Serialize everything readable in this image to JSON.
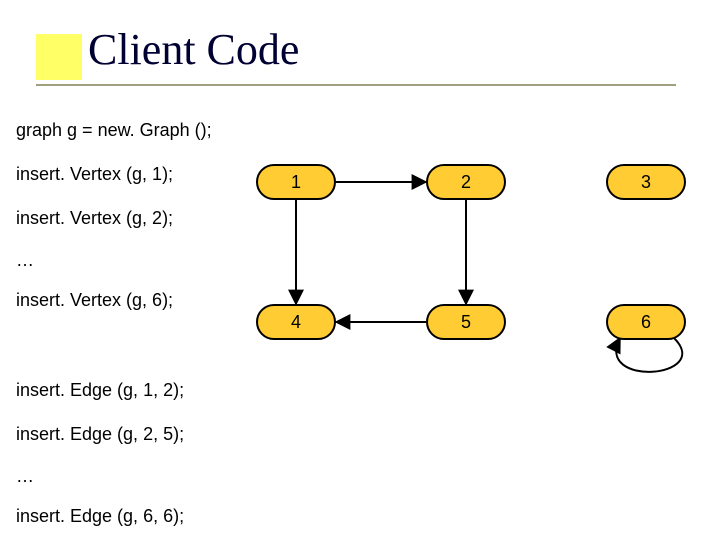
{
  "title": "Client Code",
  "code_lines": {
    "l0": "graph g = new. Graph ();",
    "l1": "insert. Vertex (g, 1);",
    "l2": "insert. Vertex (g, 2);",
    "l3": "…",
    "l4": "insert. Vertex (g, 6);",
    "l5": "insert. Edge (g, 1, 2);",
    "l6": "insert. Edge (g, 2, 5);",
    "l7": "…",
    "l8": "insert. Edge (g, 6, 6);"
  },
  "nodes": {
    "n1": "1",
    "n2": "2",
    "n3": "3",
    "n4": "4",
    "n5": "5",
    "n6": "6"
  },
  "edges_description": [
    "1 -> 2",
    "1 -> 4",
    "2 -> 5",
    "5 -> 4",
    "6 -> 6 (self loop)"
  ],
  "colors": {
    "title": "#000033",
    "accent_box": "#ffff66",
    "underline": "#a0a080",
    "node_fill": "#ffcc33"
  }
}
